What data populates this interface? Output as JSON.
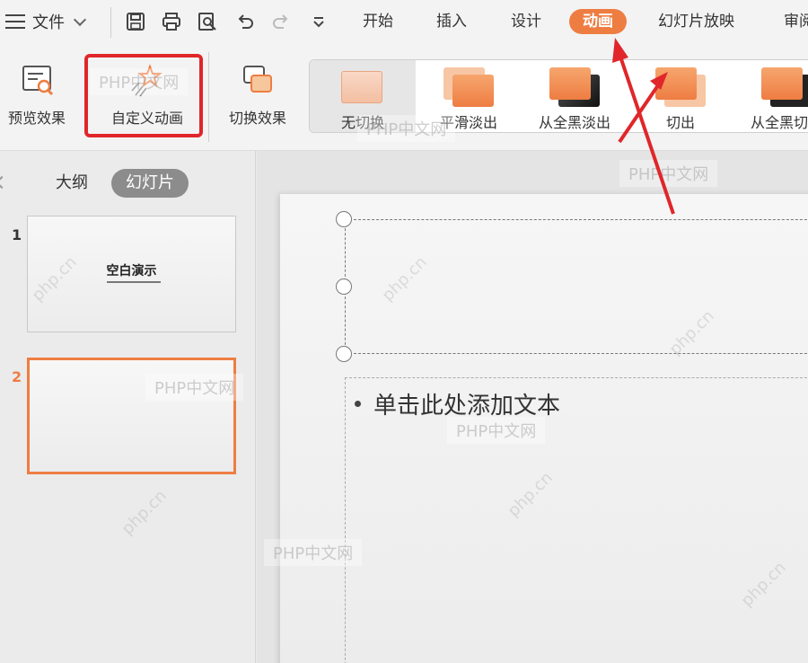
{
  "menubar": {
    "file_label": "文件",
    "tabs": [
      "开始",
      "插入",
      "设计",
      "动画",
      "幻灯片放映",
      "审阅"
    ],
    "active_tab": "动画",
    "accent": "#ee7d42"
  },
  "ribbon": {
    "preview_label": "预览效果",
    "custom_anim_label": "自定义动画",
    "switch_effect_label": "切换效果",
    "transitions": [
      "无切换",
      "平滑淡出",
      "从全黑淡出",
      "切出",
      "从全黑切出"
    ]
  },
  "left_panel": {
    "tabs": [
      "大纲",
      "幻灯片"
    ],
    "active_tab": "幻灯片",
    "slides": [
      {
        "number": "1",
        "title": "空白演示"
      },
      {
        "number": "2",
        "title": ""
      }
    ]
  },
  "slide": {
    "body_placeholder": "单击此处添加文本"
  },
  "watermarks": {
    "text": "PHP中文网",
    "diag": "php.cn"
  },
  "colors": {
    "highlight": "#e0262a",
    "accent": "#ee7d42"
  }
}
